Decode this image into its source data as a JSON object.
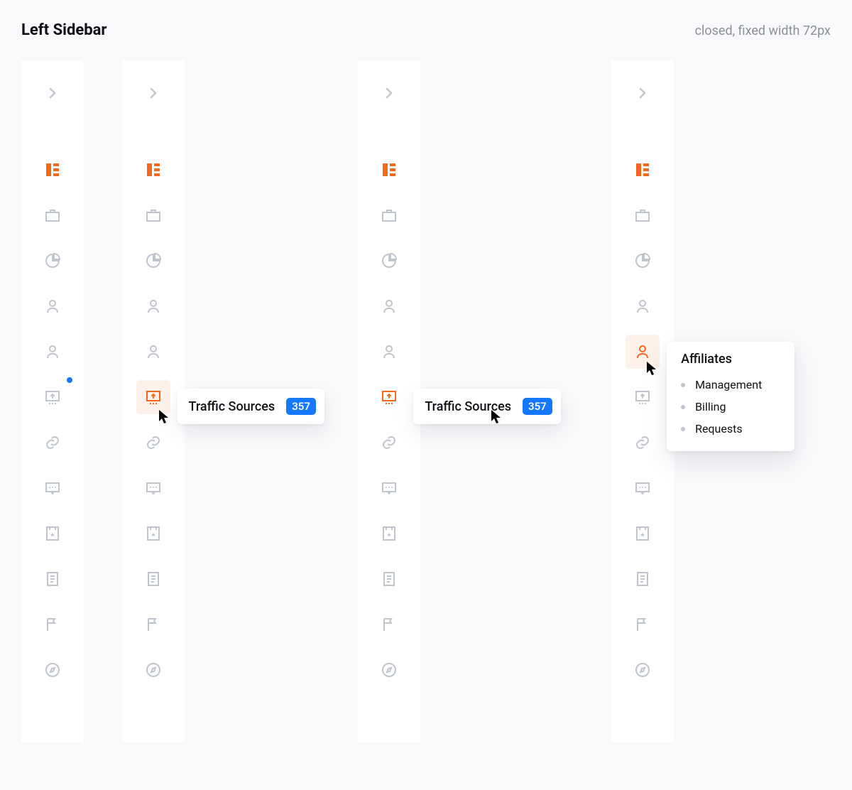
{
  "header": {
    "title": "Left Sidebar",
    "subtitle": "closed, fixed width 72px"
  },
  "accent_color": "#f36a1f",
  "badge_color": "#1677ff",
  "icons": [
    "dashboard-icon",
    "briefcase-icon",
    "pie-chart-icon",
    "person-icon",
    "person-icon",
    "upload-monitor-icon",
    "link-icon",
    "message-icon",
    "file-star-icon",
    "document-icon",
    "flag-icon",
    "compass-icon"
  ],
  "tooltip": {
    "label": "Traffic Sources",
    "badge": "357"
  },
  "submenu": {
    "title": "Affiliates",
    "items": [
      "Management",
      "Billing",
      "Requests"
    ]
  },
  "variants": {
    "v1_note": "dot indicator on Traffic Sources",
    "v2_note": "tooltip with badge, cursor on sidebar item",
    "v3_note": "tooltip with badge, cursor on tooltip",
    "v4_note": "submenu open for Affiliates"
  }
}
